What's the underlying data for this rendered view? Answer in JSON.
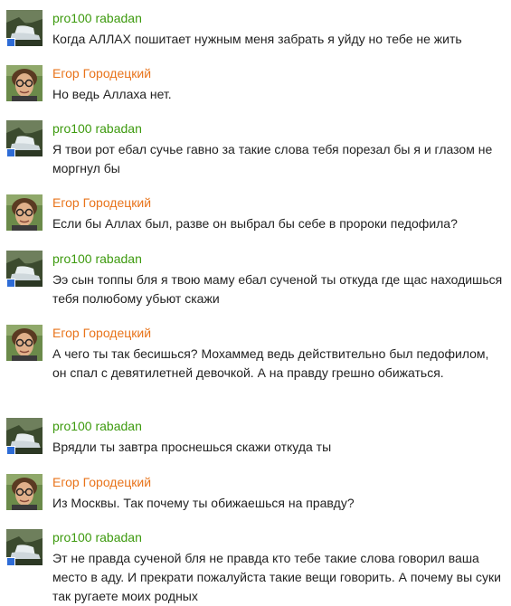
{
  "colors": {
    "author_pro100": "#3d9a0e",
    "author_egor": "#e8731a",
    "online_indicator": "#2e6cd6",
    "message_text": "#222222"
  },
  "messages": [
    {
      "author": "pro100 rabadan",
      "text": "Когда АЛЛАХ пошитает нужным меня забрать я уйду но тебе не жить"
    },
    {
      "author": "Егор Городецкий",
      "text": "Но ведь Аллаха нет."
    },
    {
      "author": "pro100 rabadan",
      "text": "Я твои рот ебал сучье гавно за такие слова тебя порезал бы я и глазом не моргнул бы"
    },
    {
      "author": "Егор Городецкий",
      "text": "Если бы Аллах был, разве он выбрал бы себе в пророки педофила?"
    },
    {
      "author": "pro100 rabadan",
      "text": "Ээ сын топпы бля я твою маму ебал сученой ты откуда где щас находишься тебя полюбому убьют скажи"
    },
    {
      "author": "Егор Городецкий",
      "text": "А чего ты так бесишься? Мохаммед ведь действительно был педофилом, он спал с девятилетней девочкой. А на правду грешно обижаться."
    },
    {
      "author": "pro100 rabadan",
      "text": "Врядли ты завтра проснешься скажи откуда ты"
    },
    {
      "author": "Егор Городецкий",
      "text": "Из Москвы. Так почему ты обижаешься на правду?"
    },
    {
      "author": "pro100 rabadan",
      "text": "Эт не правда сученой бля не правда кто тебе такие слова говорил ваша место в аду. И прекрати пожалуйста такие вещи говорить. А почему вы суки так ругаете моих родных"
    }
  ]
}
